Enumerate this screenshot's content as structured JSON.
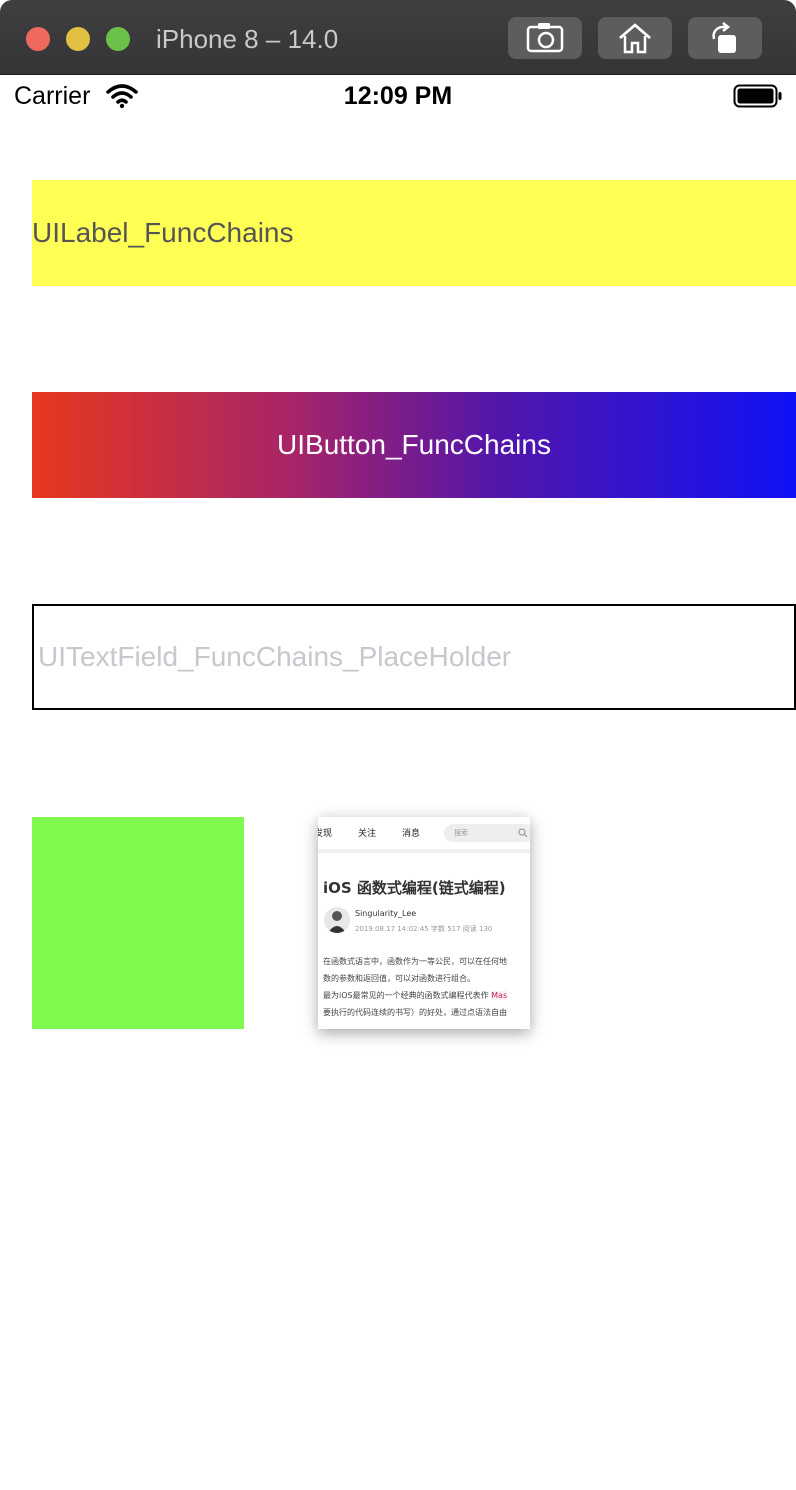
{
  "window": {
    "title": "iPhone 8 – 14.0",
    "toolbar": {
      "screenshot_icon": "camera-icon",
      "home_icon": "home-icon",
      "rotate_icon": "rotate-icon"
    }
  },
  "status_bar": {
    "carrier": "Carrier",
    "time": "12:09 PM",
    "wifi_icon": "wifi-icon",
    "battery_icon": "battery-icon"
  },
  "label": {
    "text": "UILabel_FuncChains",
    "background": "#ffff54"
  },
  "button": {
    "text": "UIButton_FuncChains",
    "gradient_start": "#e8381e",
    "gradient_end": "#0e12f6"
  },
  "text_field": {
    "placeholder": "UITextField_FuncChains_PlaceHolder"
  },
  "view": {
    "background": "#80fa4e"
  },
  "image_view": {
    "nav": [
      "发现",
      "关注",
      "消息"
    ],
    "search_placeholder": "搜索",
    "title": "iOS 函数式编程(链式编程)",
    "author": "Singularity_Lee",
    "meta": "2019.08.17 14:02:45   字数 517   阅读 130",
    "lines": [
      "在函数式语言中，函数作为一等公民，可以在任何地",
      "数的参数和返回值，可以对函数进行组合。",
      "最为iOS最常见的一个经典的函数式编程代表作",
      "要执行的代码连续的书写）的好处，通过点语法自由"
    ],
    "code_snippet": "Mas"
  }
}
